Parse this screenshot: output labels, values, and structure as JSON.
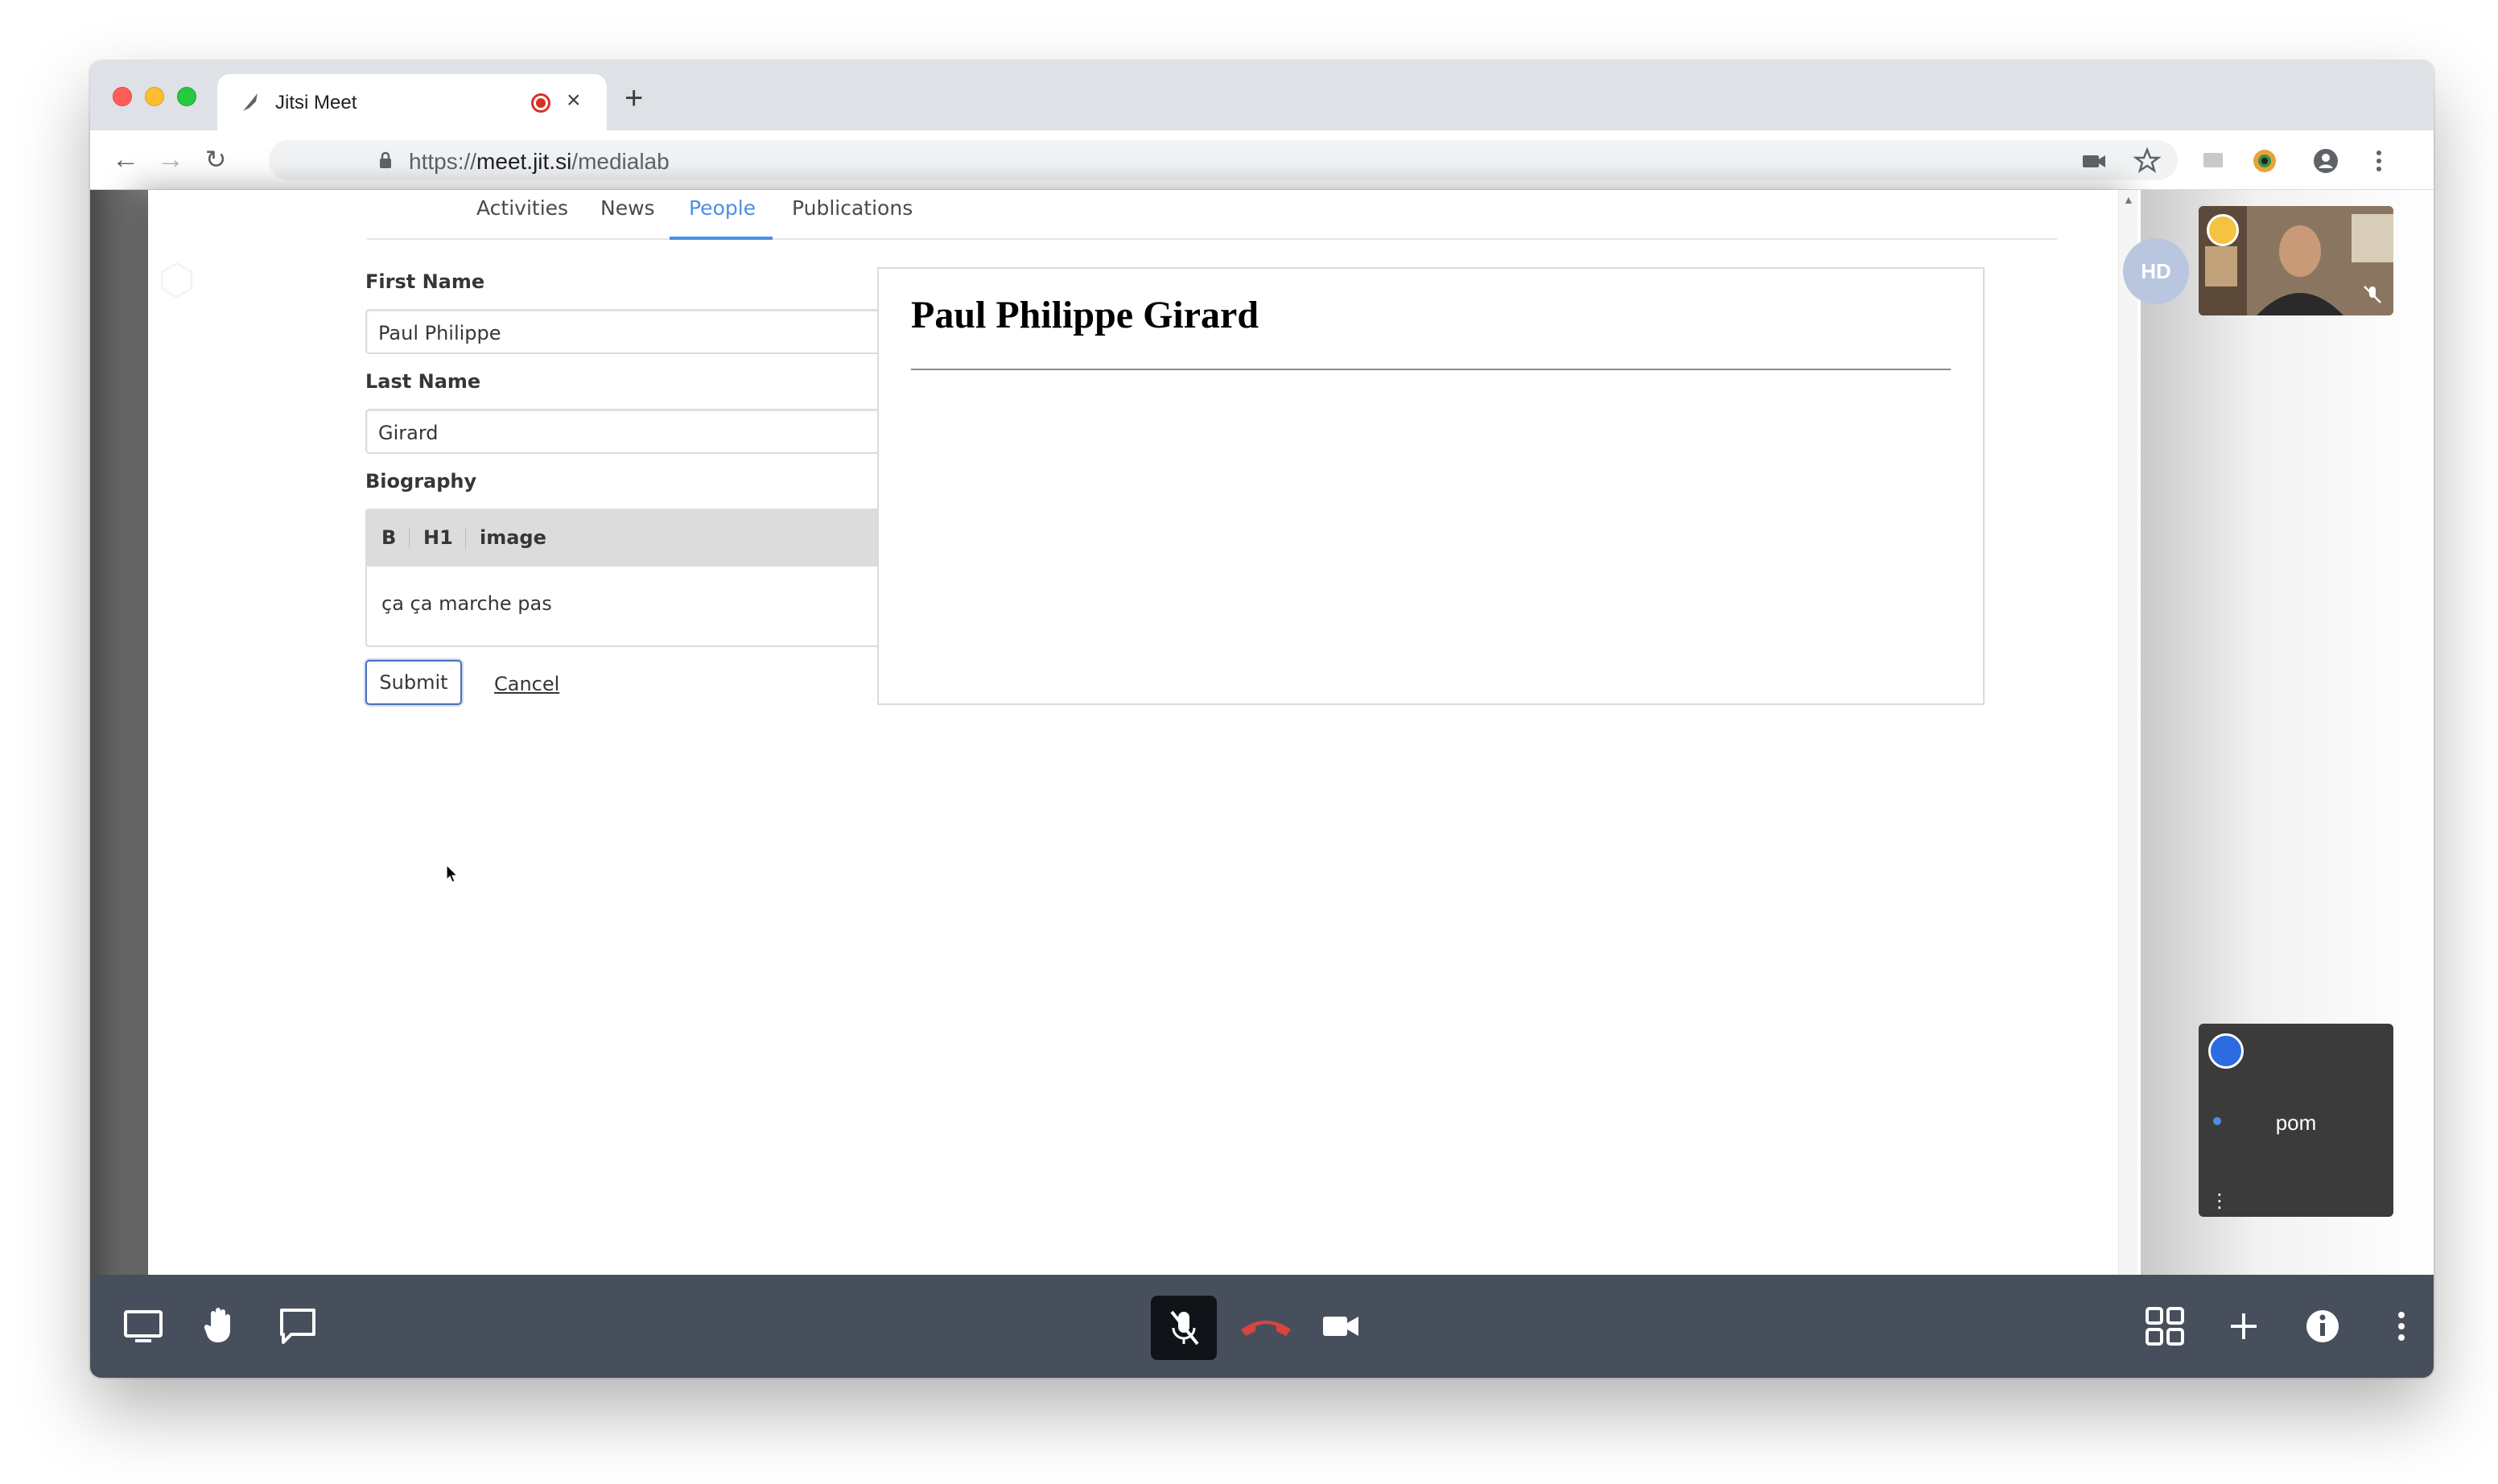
{
  "browser": {
    "tab_title": "Jitsi Meet",
    "url_scheme": "https://",
    "url_host": "meet.jit.si",
    "url_path": "/medialab"
  },
  "page": {
    "nav": {
      "tabs": [
        "Activities",
        "News",
        "People",
        "Publications"
      ],
      "active": "People"
    },
    "form": {
      "first_name_label": "First Name",
      "first_name_value": "Paul Philippe",
      "last_name_label": "Last Name",
      "last_name_value": "Girard",
      "biography_label": "Biography",
      "editor_buttons": [
        "B",
        "H1",
        "image"
      ],
      "biography_text": "ça ça marche pas",
      "submit_label": "Submit",
      "cancel_label": "Cancel"
    },
    "preview": {
      "title": "Paul Philippe Girard"
    }
  },
  "meeting": {
    "hd_badge": "HD",
    "participant_name": "pom"
  },
  "colors": {
    "accent": "#4a90e2",
    "toolbar_bg": "#474f5c",
    "hangup": "#d9453d"
  }
}
